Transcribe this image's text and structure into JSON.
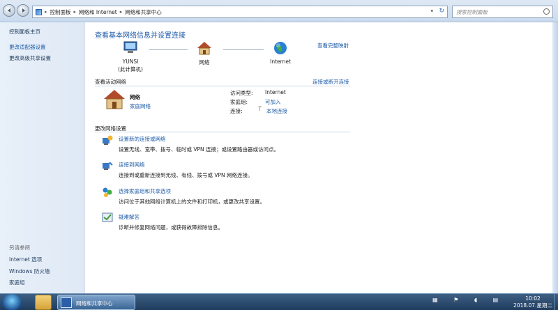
{
  "address_bar": {
    "crumbs": [
      "控制面板",
      "网络和 Internet",
      "网络和共享中心"
    ],
    "search_placeholder": "搜索控制面板"
  },
  "sidebar": {
    "home": "控制面板主页",
    "adapter": "更改适配器设置",
    "sharing": "更改高级共享设置",
    "see_also_title": "另请参阅",
    "see_also": [
      "Internet 选项",
      "Windows 防火墙",
      "家庭组"
    ]
  },
  "main": {
    "title": "查看基本网络信息并设置连接",
    "full_map": "查看完整映射",
    "map": {
      "computer_name": "YUNSI",
      "computer_sub": "(此计算机)",
      "network": "网络",
      "internet": "Internet"
    },
    "active_header": "查看活动网络",
    "connect_disconnect": "连接或断开连接",
    "active_network": {
      "name": "网络",
      "type": "家庭网络",
      "access_type_label": "访问类型:",
      "access_type_value": "Internet",
      "homegroup_label": "家庭组:",
      "homegroup_value": "可加入",
      "connections_label": "连接:",
      "connections_value": "本地连接"
    },
    "settings_header": "更改网络设置",
    "tasks": [
      {
        "title": "设置新的连接或网络",
        "desc": "设置无线、宽带、拨号、临时或 VPN 连接；或设置路由器或访问点。"
      },
      {
        "title": "连接到网络",
        "desc": "连接到或重新连接到无线、有线、拨号或 VPN 网络连接。"
      },
      {
        "title": "选择家庭组和共享选项",
        "desc": "访问位于其他网络计算机上的文件和打印机，或更改共享设置。"
      },
      {
        "title": "疑难解答",
        "desc": "诊断并修复网络问题，或获得故障排除信息。"
      }
    ]
  },
  "taskbar": {
    "active_window": "网络和共享中心",
    "time": "10:02",
    "date": "2018.07.星期二"
  }
}
